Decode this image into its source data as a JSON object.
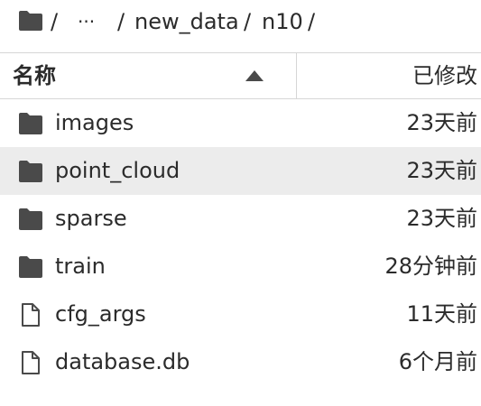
{
  "breadcrumb": {
    "icon": "folder-icon",
    "sep1": "/",
    "ellipsis": "···",
    "sep2": "/",
    "segment1": "new_data",
    "sep3": "/",
    "segment2": "n10",
    "sep4": "/"
  },
  "header": {
    "name_label": "名称",
    "sort_icon": "sort-ascending-icon",
    "modified_label": "已修改"
  },
  "rows": [
    {
      "type": "folder",
      "icon": "folder-icon",
      "name": "images",
      "modified": "23天前",
      "selected": false
    },
    {
      "type": "folder",
      "icon": "folder-icon",
      "name": "point_cloud",
      "modified": "23天前",
      "selected": true
    },
    {
      "type": "folder",
      "icon": "folder-icon",
      "name": "sparse",
      "modified": "23天前",
      "selected": false
    },
    {
      "type": "folder",
      "icon": "folder-icon",
      "name": "train",
      "modified": "28分钟前",
      "selected": false
    },
    {
      "type": "file",
      "icon": "file-icon",
      "name": "cfg_args",
      "modified": "11天前",
      "selected": false
    },
    {
      "type": "file",
      "icon": "file-icon",
      "name": "database.db",
      "modified": "6个月前",
      "selected": false
    }
  ],
  "colors": {
    "text": "#2b2b2b",
    "icon": "#4a4a4a",
    "selected_row": "#ececec",
    "divider": "#d6d6d6"
  }
}
